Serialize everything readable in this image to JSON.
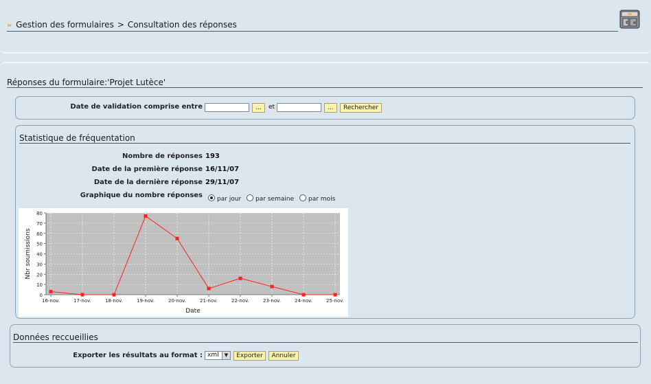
{
  "breadcrumb": {
    "arrow": "»",
    "item1": "Gestion des formulaires",
    "separator": ">",
    "item2": "Consultation des réponses"
  },
  "app_icon": "admin-app-icon",
  "page_title": "Réponses du formulaire:'Projet Lutèce'",
  "filter": {
    "label": "Date de validation comprise entre",
    "date_from": "",
    "date_to": "",
    "picker_label": "...",
    "and_label": "et",
    "search_label": "Rechercher"
  },
  "stats": {
    "title": "Statistique de fréquentation",
    "rows": [
      {
        "label": "Nombre de réponses",
        "value": "193"
      },
      {
        "label": "Date de la première réponse",
        "value": "16/11/07"
      },
      {
        "label": "Date de la dernière réponse",
        "value": "29/11/07"
      }
    ],
    "graph_label": "Graphique du nombre réponses",
    "options": [
      "par jour",
      "par semaine",
      "par mois"
    ],
    "selected": "par jour"
  },
  "chart_data": {
    "type": "line",
    "categories": [
      "16-nov.",
      "17-nov.",
      "18-nov.",
      "19-nov.",
      "20-nov.",
      "21-nov.",
      "22-nov.",
      "23-nov.",
      "24-nov.",
      "25-nov."
    ],
    "series": [
      {
        "values": [
          3,
          0,
          0,
          77,
          55,
          6,
          16,
          8,
          0,
          0
        ]
      }
    ],
    "xlabel": "Date",
    "ylabel": "Nbr soumissions",
    "ylim": [
      0,
      80
    ],
    "yticks": [
      0,
      10,
      20,
      30,
      40,
      50,
      60,
      70,
      80
    ],
    "grid": true,
    "colors": {
      "line": "#ff2020",
      "plot_bg": "#c0c0c0",
      "grid": "#ffffff"
    }
  },
  "export": {
    "title": "Données reccueillies",
    "label": "Exporter les résultats au format :",
    "format": "xml",
    "export_label": "Exporter",
    "cancel_label": "Annuler"
  }
}
